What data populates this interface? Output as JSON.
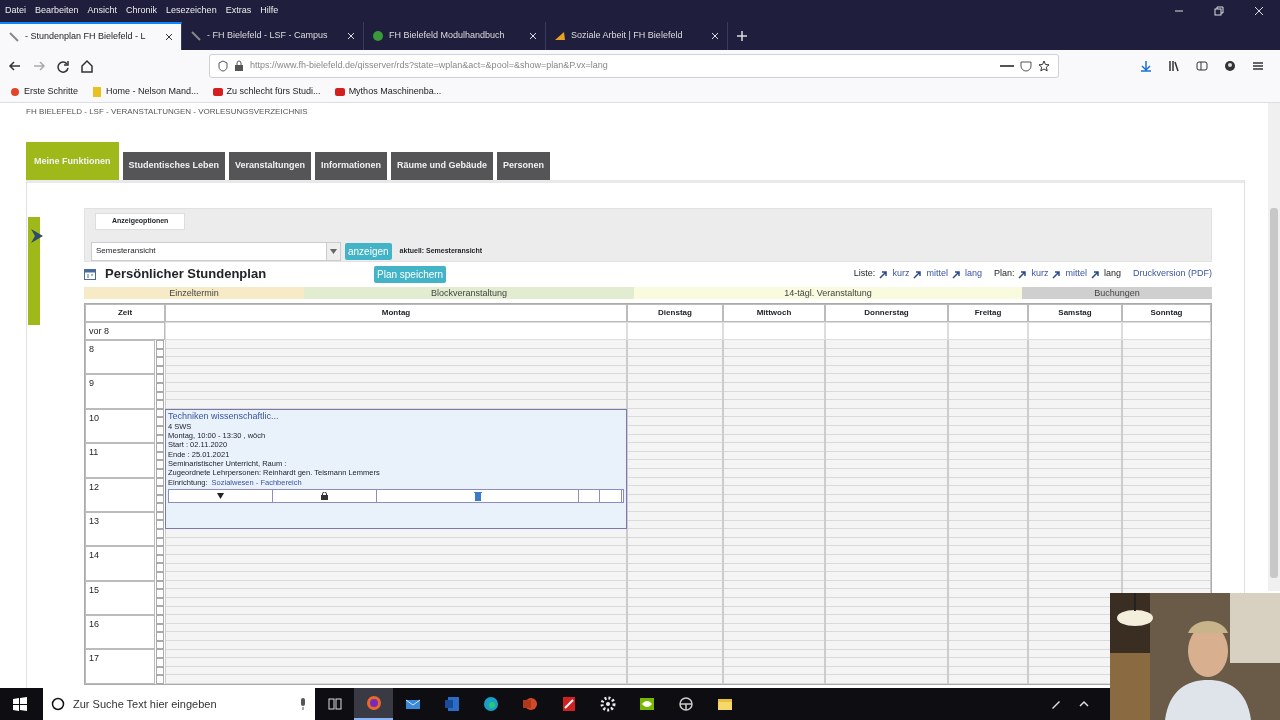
{
  "menubar": [
    "Datei",
    "Bearbeiten",
    "Ansicht",
    "Chronik",
    "Lesezeichen",
    "Extras",
    "Hilfe"
  ],
  "browser_tabs": [
    {
      "title": "- Stundenplan FH Bielefeld - L",
      "selected": true
    },
    {
      "title": "- FH Bielefeld - LSF - Campus",
      "selected": false
    },
    {
      "title": "FH Bielefeld Modulhandbuch",
      "selected": false
    },
    {
      "title": "Soziale Arbeit | FH Bielefeld",
      "selected": false
    }
  ],
  "url": "https://www.fh-bielefeld.de/qisserver/rds?state=wplan&act=&pool=&show=plan&P.vx=lang",
  "bookmarks": [
    "Erste Schritte",
    "Home - Nelson Mand...",
    "Zu schlecht fürs Studi...",
    "Mythos Maschinenba..."
  ],
  "breadcrumb": "FH BIELEFELD - LSF - VERANSTALTUNGEN - VORLESUNGSVERZEICHNIS",
  "nav_tabs": [
    {
      "label": "Meine Funktionen",
      "selected": true
    },
    {
      "label": "Studentisches Leben",
      "selected": false
    },
    {
      "label": "Veranstaltungen",
      "selected": false
    },
    {
      "label": "Informationen",
      "selected": false
    },
    {
      "label": "Räume und Gebäude",
      "selected": false
    },
    {
      "label": "Personen",
      "selected": false
    }
  ],
  "options": {
    "legend": "Anzeigeoptionen",
    "select_value": "Semesteransicht",
    "button": "anzeigen",
    "current": "aktuell: Semesteransicht"
  },
  "plan": {
    "title": "Persönlicher Stundenplan",
    "save_button": "Plan speichern",
    "groups": [
      {
        "label": "Liste:",
        "links": [
          {
            "label": "kurz",
            "selected": false
          },
          {
            "label": "mittel",
            "selected": false
          },
          {
            "label": "lang",
            "selected": false
          }
        ]
      },
      {
        "label": "Plan:",
        "links": [
          {
            "label": "kurz",
            "selected": false
          },
          {
            "label": "mittel",
            "selected": false
          },
          {
            "label": "lang",
            "selected": true
          }
        ]
      }
    ],
    "print_link": "Druckversion (PDF)"
  },
  "legend": [
    {
      "label": "Einzeltermin",
      "color": "#f6ebc6"
    },
    {
      "label": "Blockveranstaltung",
      "color": "#e2ecd0"
    },
    {
      "label": "14-tägl. Veranstaltung",
      "color": "#fafadf"
    },
    {
      "label": "Buchungen",
      "color": "#cfcfcf"
    }
  ],
  "table": {
    "columns": [
      "Zeit",
      "Montag",
      "Dienstag",
      "Mittwoch",
      "Donnerstag",
      "Freitag",
      "Samstag",
      "Sonntag"
    ],
    "before_row": "vor 8",
    "hours": [
      "8",
      "9",
      "10",
      "11",
      "12",
      "13",
      "14",
      "15",
      "16",
      "17"
    ],
    "events": [
      {
        "title": "Techniken wissenschaftlic...",
        "lines": [
          "4 SWS",
          "Montag, 10:00 - 13:30 , wöch",
          "Start : 02.11.2020",
          "Ende : 25.01.2021",
          "Seminaristischer Unterricht, Raum :",
          "Zugeordnete Lehrpersonen: Reinhardt gen. Teismann Lemmers"
        ],
        "facility_label": "Einrichtung:",
        "facility_link": "Sozialwesen - Fachbereich"
      }
    ]
  },
  "taskbar": {
    "search_placeholder": "Zur Suche Text hier eingeben",
    "apps": [
      {
        "kind": "firefox",
        "selected": true
      },
      {
        "kind": "mail",
        "selected": false
      },
      {
        "kind": "word",
        "selected": false
      },
      {
        "kind": "edge",
        "selected": false
      },
      {
        "kind": "powerpoint",
        "selected": false
      },
      {
        "kind": "tool",
        "selected": false
      },
      {
        "kind": "settings",
        "selected": false
      },
      {
        "kind": "nvidia",
        "selected": false
      },
      {
        "kind": "wheel",
        "selected": false
      },
      {
        "kind": "explorer",
        "selected": false
      }
    ]
  }
}
